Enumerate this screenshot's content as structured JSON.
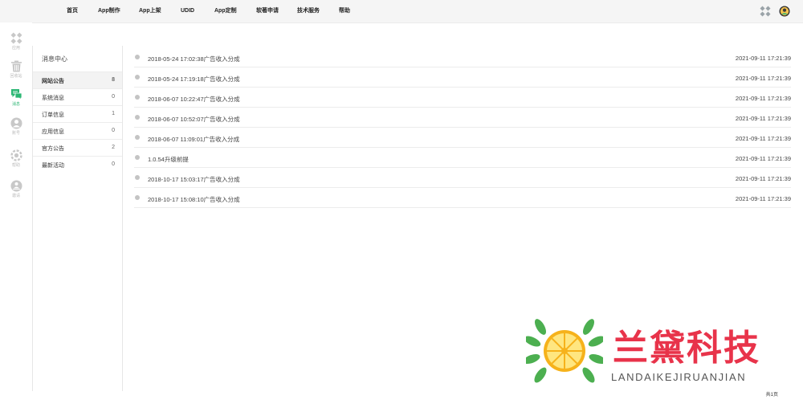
{
  "nav": {
    "items": [
      "首页",
      "App制作",
      "App上架",
      "UDID",
      "App定制",
      "软著申请",
      "技术服务",
      "帮助"
    ]
  },
  "topbar_icons": [
    "apps-grid-icon",
    "user-avatar-icon"
  ],
  "sidebar": {
    "items": [
      {
        "label": "应用",
        "icon": "apps-grid-icon"
      },
      {
        "label": "回收站",
        "icon": "trash-icon"
      },
      {
        "label": "消息",
        "icon": "message-icon",
        "active": true
      },
      {
        "label": "账号",
        "icon": "account-icon"
      },
      {
        "label": "帮助",
        "icon": "help-icon"
      },
      {
        "label": "邀请",
        "icon": "invite-icon"
      }
    ]
  },
  "message_menu": {
    "title": "消息中心",
    "items": [
      {
        "label": "网站公告",
        "count": "8"
      },
      {
        "label": "系统消息",
        "count": "0"
      },
      {
        "label": "订单信息",
        "count": "1"
      },
      {
        "label": "应用信息",
        "count": "0"
      },
      {
        "label": "官方公告",
        "count": "2"
      },
      {
        "label": "最新活动",
        "count": "0"
      }
    ]
  },
  "messages": [
    {
      "title": "2018-05-24 17:02:38广告收入分成",
      "time": "2021-09-11 17:21:39"
    },
    {
      "title": "2018-05-24 17:19:18广告收入分成",
      "time": "2021-09-11 17:21:39"
    },
    {
      "title": "2018-06-07 10:22:47广告收入分成",
      "time": "2021-09-11 17:21:39"
    },
    {
      "title": "2018-06-07 10:52:07广告收入分成",
      "time": "2021-09-11 17:21:39"
    },
    {
      "title": "2018-06-07 11:09:01广告收入分成",
      "time": "2021-09-11 17:21:39"
    },
    {
      "title": "1.0.54升级前提",
      "time": "2021-09-11 17:21:39"
    },
    {
      "title": "2018-10-17 15:03:17广告收入分成",
      "time": "2021-09-11 17:21:39"
    },
    {
      "title": "2018-10-17 15:08:10广告收入分成",
      "time": "2021-09-11 17:21:39"
    }
  ],
  "pager": {
    "text": "共1页"
  },
  "watermark": {
    "cn": "兰黛科技",
    "en": "LANDAIKEJIRUANJIAN"
  },
  "colors": {
    "accent": "#2bb673",
    "watermark_red": "#e8334a",
    "topbar_bg": "#f5f5f5"
  }
}
